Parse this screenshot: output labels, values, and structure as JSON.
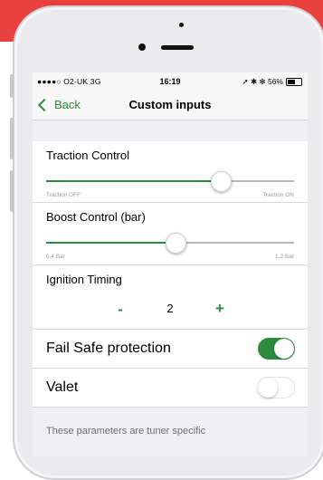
{
  "status_bar": {
    "carrier": "●●●●○ O2-UK  3G",
    "time": "16:19",
    "right": "➚ ✱ ✻ 56%"
  },
  "nav": {
    "back_label": "Back",
    "title": "Custom inputs"
  },
  "traction": {
    "label": "Traction Control",
    "min_label": "Traction OFF",
    "max_label": "Traction ON",
    "value_fraction": 0.7
  },
  "boost": {
    "label": "Boost Control (bar)",
    "min_label": "0.4 Bar",
    "max_label": "1.2 Bar",
    "value_fraction": 0.52
  },
  "ignition": {
    "label": "Ignition Timing",
    "minus": "-",
    "value": "2",
    "plus": "+"
  },
  "fail_safe": {
    "label": "Fail Safe protection",
    "on": true
  },
  "valet": {
    "label": "Valet",
    "on": false
  },
  "footer": "These parameters are tuner specific",
  "colors": {
    "accent": "#2e8b3e",
    "background_band": "#e8403c"
  }
}
